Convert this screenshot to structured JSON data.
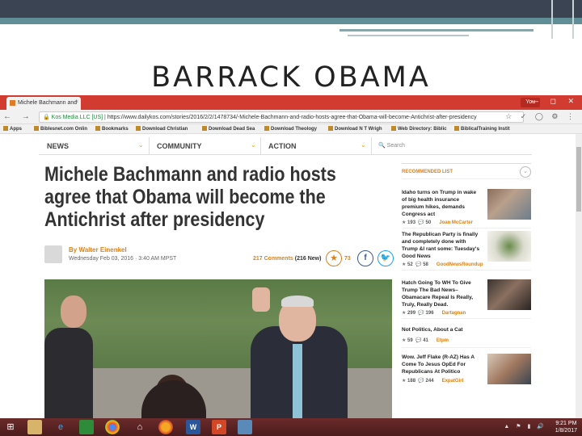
{
  "slide": {
    "title": "BARRACK OBAMA"
  },
  "browser": {
    "tab_title": "Michele Bachmann and",
    "tab_close": "×",
    "profile_button": "You",
    "window_controls": "— ◻ ✕",
    "nav_buttons": "← → C",
    "security_label": "Kos Media LLC [US]",
    "url": "https://www.dailykos.com/stories/2016/2/2/1478734/-Michele-Bachmann-and-radio-hosts-agree-that-Obama-will-become-Antichrist-after-presidency",
    "extensions": "☆ ✓ ◯ ⚙ ⋮",
    "bookmarks": [
      "Apps",
      "Biblesnet.com Onlin",
      "Bookmarks",
      "Download Christian",
      "Download Dead Sea",
      "Download Theology",
      "Download N T Wrigh",
      "Web Directory: Biblic",
      "BiblicalTraining Instit"
    ]
  },
  "site_nav": {
    "items": [
      "NEWS",
      "COMMUNITY",
      "ACTION"
    ],
    "chevron": "⌄",
    "search": "Search"
  },
  "article": {
    "headline": "Michele Bachmann and radio hosts agree that Obama will become the Antichrist after presidency",
    "author": "By Walter Einenkel",
    "date": "Wednesday Feb 03, 2016 · 3:40 AM MPST",
    "comments": "217 Comments",
    "comments_new": "(216 New)",
    "recommend_count": "73",
    "star": "★",
    "facebook": "f",
    "twitter": "🐦"
  },
  "sidebar": {
    "heading": "RECOMMENDED LIST",
    "collapse": "⌄",
    "items": [
      {
        "title": "Idaho turns on Trump in wake of big health insurance premium hikes, demands Congress act",
        "recs": "193",
        "comments": "50",
        "author": "Joan McCarter"
      },
      {
        "title": "The Republican Party is finally and completely done with Trump &I rant some: Tuesday's Good News",
        "recs": "52",
        "comments": "58",
        "author": "GoodNewsRoundup"
      },
      {
        "title": "Hatch Going To WH To Give Trump The Bad News–Obamacare Repeal Is Really, Truly, Really Dead.",
        "recs": "299",
        "comments": "196",
        "author": "Dartagnan"
      },
      {
        "title": "Not Politics, About a Cat",
        "recs": "59",
        "comments": "41",
        "author": "Etpm"
      },
      {
        "title": "Wow. Jeff Flake (R-AZ) Has A Come To Jesus OpEd For Republicans At Politico",
        "recs": "188",
        "comments": "244",
        "author": "ExpatGirl"
      }
    ]
  },
  "taskbar": {
    "time": "9:21 PM",
    "date": "1/8/2017",
    "tray": "▲ ⚑ ▮ 🔊"
  }
}
